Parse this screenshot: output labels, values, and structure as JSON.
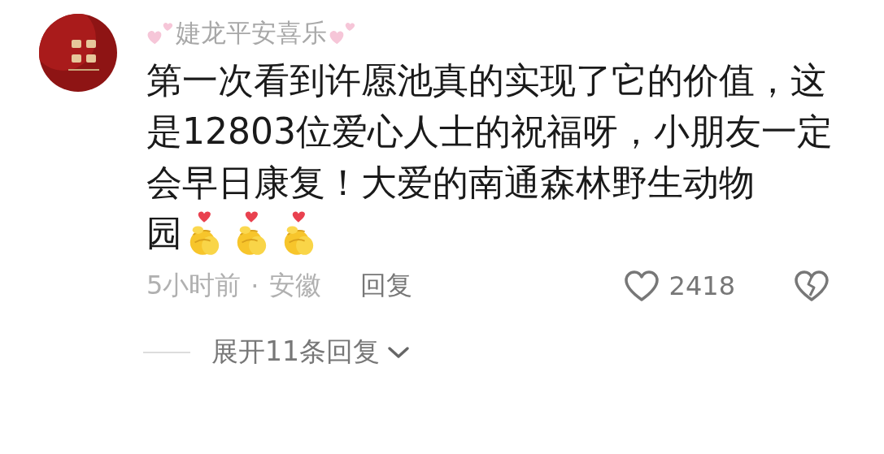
{
  "comment": {
    "author": "婕龙平安喜乐",
    "text": "第一次看到许愿池真的实现了它的价值，这是12803位爱心人士的祝福呀，小朋友一定会早日康复！大爱的南通森林野生动物",
    "text_end": "园",
    "time": "5小时前",
    "separator": "·",
    "location": "安徽",
    "reply_label": "回复",
    "likes": "2418",
    "expand_replies": "展开11条回复"
  }
}
